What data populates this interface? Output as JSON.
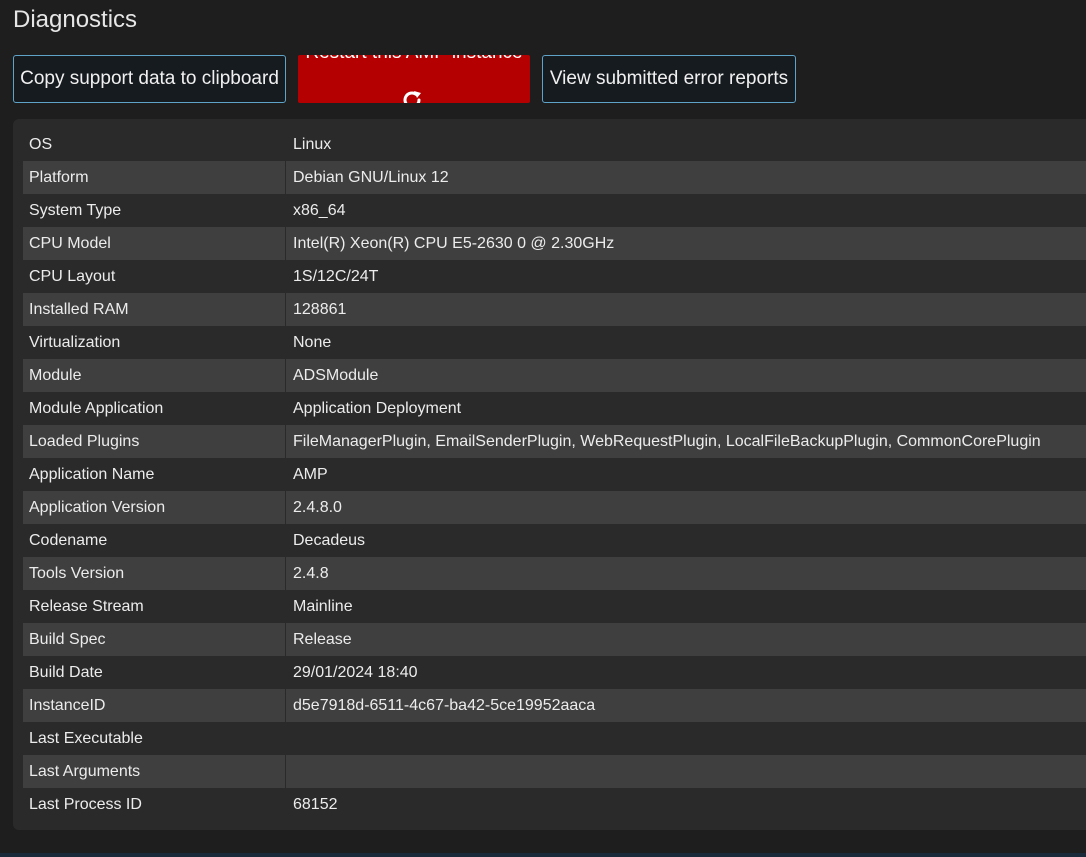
{
  "page": {
    "title": "Diagnostics"
  },
  "buttons": {
    "copy_support": "Copy support data to clipboard",
    "restart_instance": "Restart this AMP instance",
    "view_reports": "View submitted error reports"
  },
  "colors": {
    "restart_button_bg": "#b40000",
    "button_border": "#5fa3c9"
  },
  "icons": {
    "restart": "refresh-icon"
  },
  "diagnostics": [
    {
      "key": "OS",
      "value": "Linux"
    },
    {
      "key": "Platform",
      "value": "Debian GNU/Linux 12"
    },
    {
      "key": "System Type",
      "value": "x86_64"
    },
    {
      "key": "CPU Model",
      "value": "Intel(R) Xeon(R) CPU E5-2630 0 @ 2.30GHz"
    },
    {
      "key": "CPU Layout",
      "value": "1S/12C/24T"
    },
    {
      "key": "Installed RAM",
      "value": "128861"
    },
    {
      "key": "Virtualization",
      "value": "None"
    },
    {
      "key": "Module",
      "value": "ADSModule"
    },
    {
      "key": "Module Application",
      "value": "Application Deployment"
    },
    {
      "key": "Loaded Plugins",
      "value": "FileManagerPlugin, EmailSenderPlugin, WebRequestPlugin, LocalFileBackupPlugin, CommonCorePlugin"
    },
    {
      "key": "Application Name",
      "value": "AMP"
    },
    {
      "key": "Application Version",
      "value": "2.4.8.0"
    },
    {
      "key": "Codename",
      "value": "Decadeus"
    },
    {
      "key": "Tools Version",
      "value": "2.4.8"
    },
    {
      "key": "Release Stream",
      "value": "Mainline"
    },
    {
      "key": "Build Spec",
      "value": "Release"
    },
    {
      "key": "Build Date",
      "value": "29/01/2024 18:40"
    },
    {
      "key": "InstanceID",
      "value": "d5e7918d-6511-4c67-ba42-5ce19952aaca"
    },
    {
      "key": "Last Executable",
      "value": ""
    },
    {
      "key": "Last Arguments",
      "value": ""
    },
    {
      "key": "Last Process ID",
      "value": "68152"
    }
  ]
}
